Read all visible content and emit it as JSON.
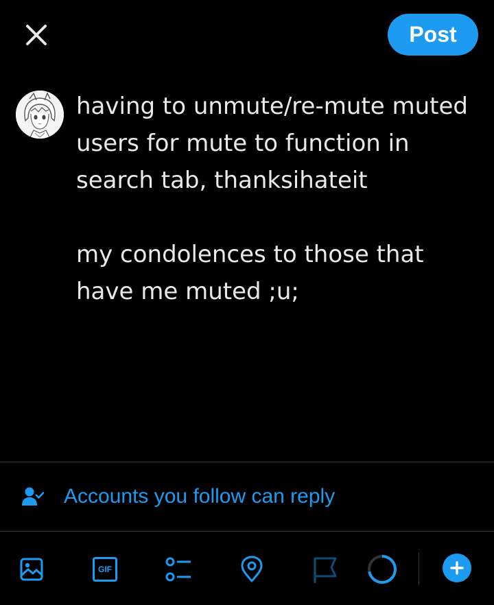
{
  "header": {
    "close_icon": "close-icon",
    "post_label": "Post"
  },
  "composer": {
    "avatar": "user-avatar",
    "text": "having to unmute/re-mute muted\nusers for mute to function in\nsearch tab, thanksihateit\n\nmy condolences to those that\nhave me muted ;u;"
  },
  "reply_settings": {
    "icon": "person-check-icon",
    "label": "Accounts you follow can reply"
  },
  "toolbar": {
    "items": [
      {
        "icon": "image-icon"
      },
      {
        "icon": "gif-icon",
        "text": "GIF"
      },
      {
        "icon": "poll-icon"
      },
      {
        "icon": "location-icon"
      },
      {
        "icon": "flag-icon"
      },
      {
        "icon": "character-count-ring",
        "progress": 0.72
      }
    ],
    "add_icon": "add-icon"
  },
  "colors": {
    "accent": "#1d9bf0",
    "background": "#000000",
    "text": "#e7e9ea",
    "divider": "#2f3336",
    "disabled_icon": "#0e4d78"
  }
}
